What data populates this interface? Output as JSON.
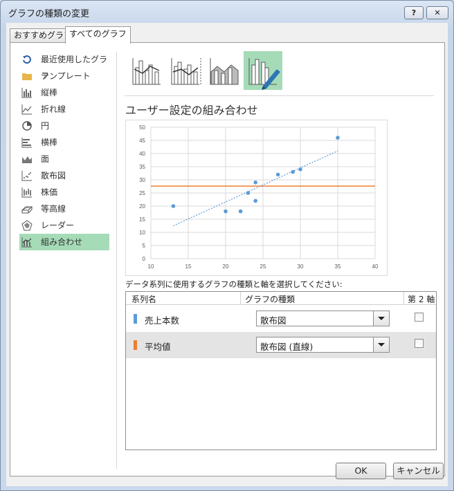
{
  "window": {
    "title": "グラフの種類の変更",
    "help_label": "?",
    "close_label": "✕"
  },
  "tabs": [
    {
      "label": "おすすめグラフ"
    },
    {
      "label": "すべてのグラフ"
    }
  ],
  "sidebar": {
    "items": [
      {
        "label": "最近使用したグラフ",
        "icon": "recent-icon"
      },
      {
        "label": "テンプレート",
        "icon": "folder-icon"
      },
      {
        "label": "縦棒",
        "icon": "column-chart-icon"
      },
      {
        "label": "折れ線",
        "icon": "line-chart-icon"
      },
      {
        "label": "円",
        "icon": "pie-chart-icon"
      },
      {
        "label": "横棒",
        "icon": "bar-chart-icon"
      },
      {
        "label": "面",
        "icon": "area-chart-icon"
      },
      {
        "label": "散布図",
        "icon": "scatter-chart-icon"
      },
      {
        "label": "株価",
        "icon": "stock-chart-icon"
      },
      {
        "label": "等高線",
        "icon": "surface-chart-icon"
      },
      {
        "label": "レーダー",
        "icon": "radar-chart-icon"
      },
      {
        "label": "組み合わせ",
        "icon": "combo-chart-icon"
      }
    ],
    "selected_index": 11
  },
  "subtypes": {
    "selected_index": 3
  },
  "section_title": "ユーザー設定の組み合わせ",
  "chart_data": {
    "type": "scatter",
    "xlim": [
      10,
      40
    ],
    "ylim": [
      0,
      50
    ],
    "x_ticks": [
      10,
      15,
      20,
      25,
      30,
      35,
      40
    ],
    "y_ticks": [
      0,
      5,
      10,
      15,
      20,
      25,
      30,
      35,
      40,
      45,
      50
    ],
    "grid": true,
    "series": [
      {
        "kind": "scatter",
        "color": "#5b9bd5",
        "points": [
          [
            13,
            20
          ],
          [
            20,
            18
          ],
          [
            22,
            18
          ],
          [
            23,
            25
          ],
          [
            24,
            29
          ],
          [
            24,
            22
          ],
          [
            27,
            32
          ],
          [
            29,
            33
          ],
          [
            30,
            34
          ],
          [
            35,
            46
          ]
        ]
      },
      {
        "kind": "line",
        "color": "#ed7d31",
        "points": [
          [
            10,
            27.6
          ],
          [
            40,
            27.6
          ]
        ]
      }
    ],
    "trendline": {
      "style": "dotted",
      "color": "#5b9bd5",
      "points": [
        [
          13,
          12.5
        ],
        [
          35,
          41
        ]
      ]
    }
  },
  "instructions": "データ系列に使用するグラフの種類と軸を選択してください:",
  "series_table": {
    "headers": {
      "name": "系列名",
      "type": "グラフの種類",
      "axis": "第 2 軸"
    },
    "rows": [
      {
        "name": "売上本数",
        "color": "#5b9bd5",
        "type": "散布図",
        "secondary_axis": false
      },
      {
        "name": "平均値",
        "color": "#ed7d31",
        "type": "散布図 (直線)",
        "secondary_axis": false
      }
    ]
  },
  "buttons": {
    "ok": "OK",
    "cancel": "キャンセル"
  }
}
